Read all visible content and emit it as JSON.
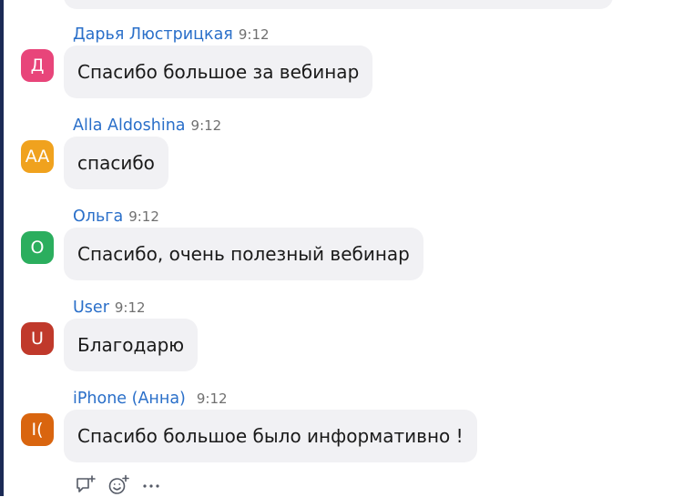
{
  "messages": [
    {
      "sender": "Дарья Люстрицкая",
      "time": "9:12",
      "avatar_text": "Д",
      "avatar_color": "#e8457a",
      "text": "Спасибо большое за вебинар"
    },
    {
      "sender": "Alla Aldoshina",
      "time": "9:12",
      "avatar_text": "AA",
      "avatar_color": "#f0a21e",
      "text": "спасибо"
    },
    {
      "sender": "Ольга",
      "time": "9:12",
      "avatar_text": "О",
      "avatar_color": "#2bae5e",
      "text": "Спасибо, очень полезный вебинар"
    },
    {
      "sender": "User",
      "time": "9:12",
      "avatar_text": "U",
      "avatar_color": "#c0392b",
      "text": "Благодарю"
    },
    {
      "sender": "iPhone (Анна)",
      "time": "9:12",
      "avatar_text": "I(",
      "avatar_color": "#d9650f",
      "text": "Спасибо большое было информативно !"
    }
  ],
  "actions": [
    "reply-icon",
    "add-reaction-icon",
    "more-options-icon"
  ]
}
